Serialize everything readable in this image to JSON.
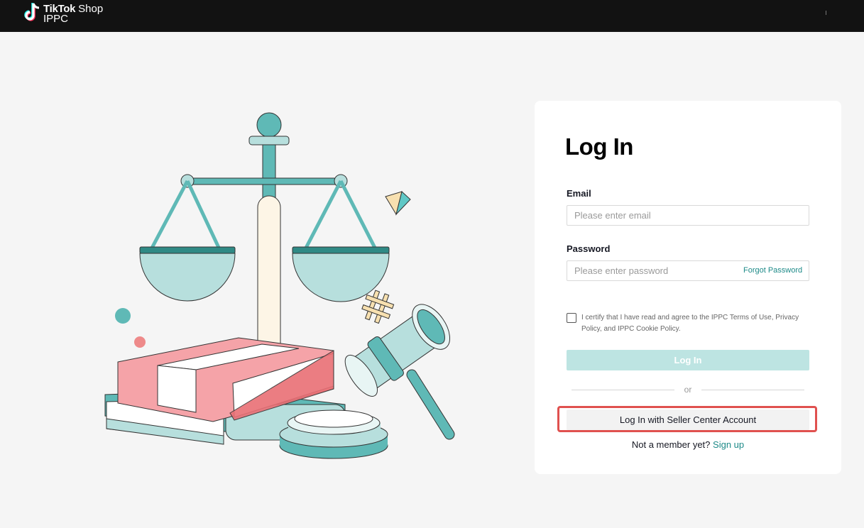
{
  "brand": {
    "tiktok": "TikTok",
    "shop": "Shop",
    "ippc": "IPPC"
  },
  "login": {
    "title": "Log In",
    "email_label": "Email",
    "email_placeholder": "Please enter email",
    "password_label": "Password",
    "password_placeholder": "Please enter password",
    "forgot_password": "Forgot Password",
    "certify_text": "I certify that I have read and agree to the IPPC Terms of Use, Privacy Policy, and IPPC Cookie Policy.",
    "login_button": "Log In",
    "or": "or",
    "seller_button": "Log In with Seller Center Account",
    "not_member": "Not a member yet?",
    "sign_up": "Sign up"
  },
  "colors": {
    "accent": "#1d8a88",
    "login_button_disabled": "#bde4e2",
    "highlight_border": "#e0514f",
    "topbar": "#121212"
  }
}
